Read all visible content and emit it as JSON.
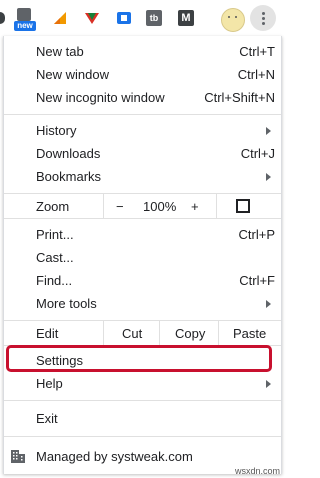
{
  "toolbar": {
    "extension_badge": "new",
    "extension_icons": [
      "new-badge-extension-icon",
      "orange-flag-extension-icon",
      "red-green-arrow-extension-icon",
      "blue-extension-icon",
      "tb-extension-icon",
      "m-extension-icon"
    ],
    "tb_text": "tb",
    "m_text": "M"
  },
  "menu": {
    "new_tab": {
      "label": "New tab",
      "shortcut": "Ctrl+T"
    },
    "new_window": {
      "label": "New window",
      "shortcut": "Ctrl+N"
    },
    "new_incognito": {
      "label": "New incognito window",
      "shortcut": "Ctrl+Shift+N"
    },
    "history": {
      "label": "History"
    },
    "downloads": {
      "label": "Downloads",
      "shortcut": "Ctrl+J"
    },
    "bookmarks": {
      "label": "Bookmarks"
    },
    "zoom": {
      "label": "Zoom",
      "minus": "−",
      "value": "100%",
      "plus": "+"
    },
    "print": {
      "label": "Print...",
      "shortcut": "Ctrl+P"
    },
    "cast": {
      "label": "Cast..."
    },
    "find": {
      "label": "Find...",
      "shortcut": "Ctrl+F"
    },
    "more_tools": {
      "label": "More tools"
    },
    "edit": {
      "label": "Edit",
      "cut": "Cut",
      "copy": "Copy",
      "paste": "Paste"
    },
    "settings": {
      "label": "Settings"
    },
    "help": {
      "label": "Help"
    },
    "exit": {
      "label": "Exit"
    },
    "managed": {
      "label": "Managed by systweak.com"
    }
  },
  "colors": {
    "highlight": "#c8102e",
    "badge": "#1a73e8"
  },
  "watermark": "wsxdn.com"
}
